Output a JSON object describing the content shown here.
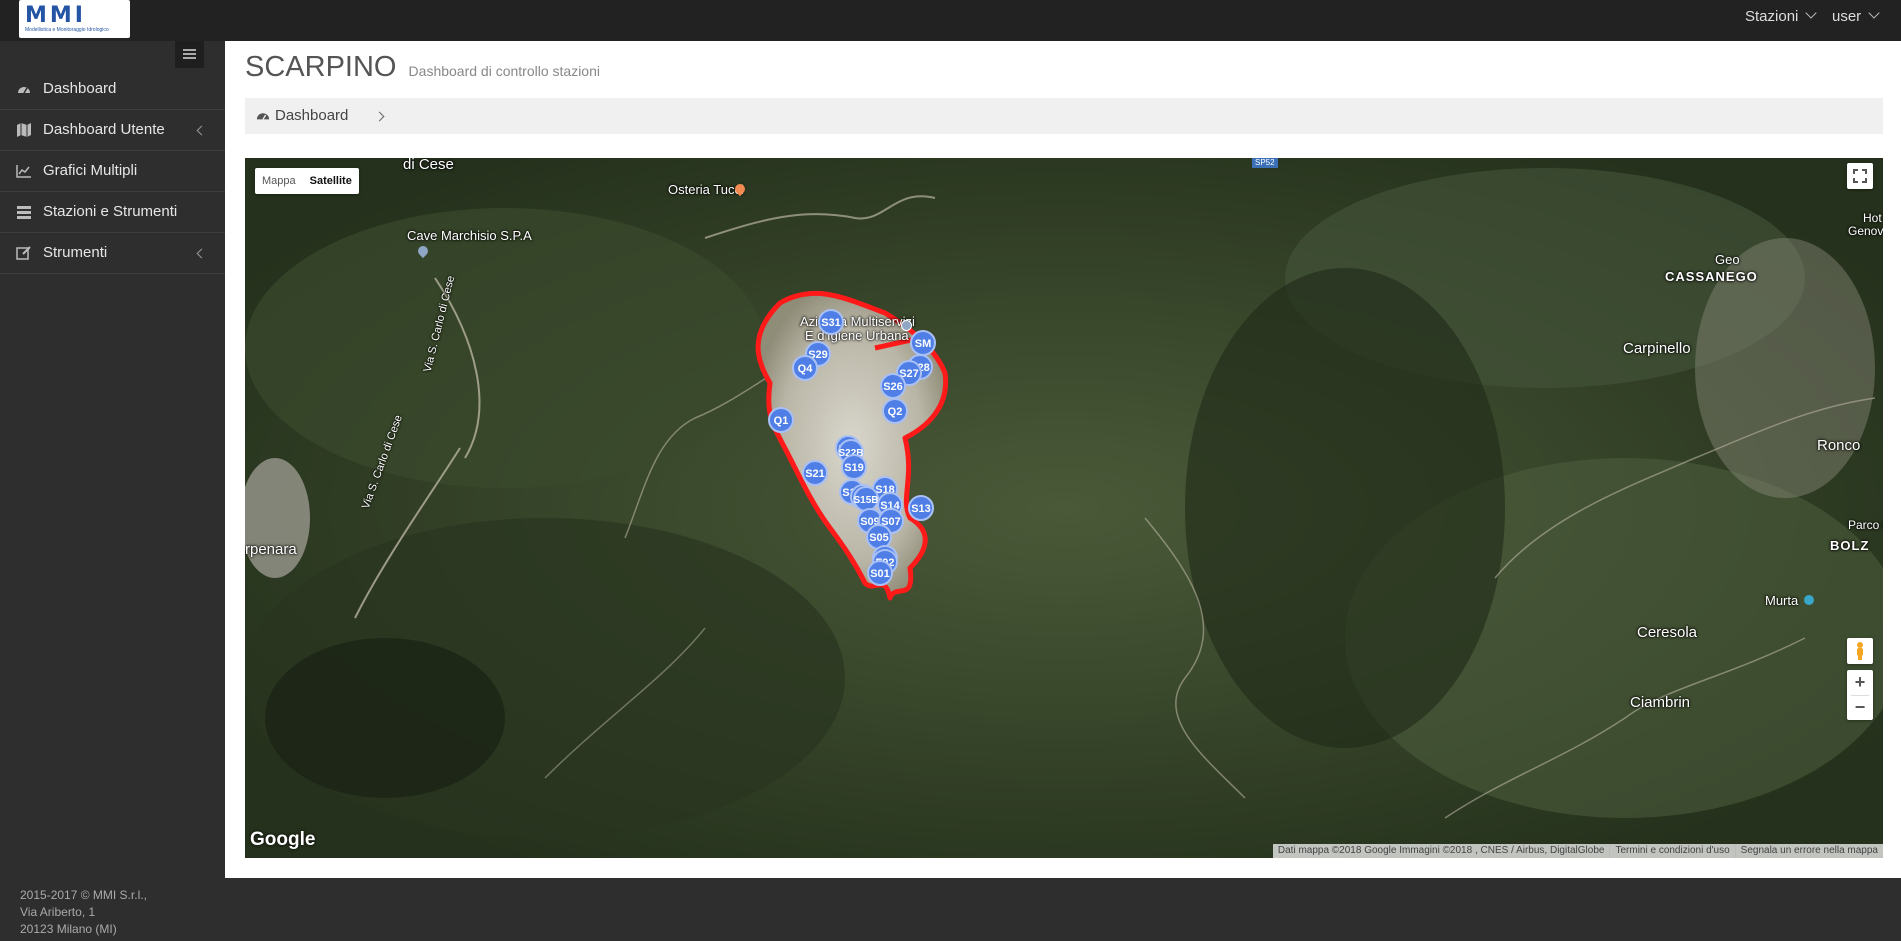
{
  "navbar": {
    "logo_text": "MMI",
    "logo_subtitle": "Modellistica e Monitoraggio Idrologico",
    "stazioni_label": "Stazioni",
    "user_label": "user"
  },
  "sidebar": {
    "items": [
      {
        "label": "Dashboard",
        "icon": "dashboard-icon",
        "has_submenu": false
      },
      {
        "label": "Dashboard Utente",
        "icon": "map-icon",
        "has_submenu": true
      },
      {
        "label": "Grafici Multipli",
        "icon": "line-chart-icon",
        "has_submenu": false
      },
      {
        "label": "Stazioni e Strumenti",
        "icon": "list-icon",
        "has_submenu": false
      },
      {
        "label": "Strumenti",
        "icon": "edit-icon",
        "has_submenu": true
      }
    ],
    "footer": {
      "line1": "2015-2017 © MMI S.r.l.,",
      "line2": "Via Ariberto, 1",
      "line3": "20123 Milano (MI)"
    }
  },
  "page": {
    "title": "SCARPINO",
    "subtitle": "Dashboard di controllo stazioni"
  },
  "breadcrumb": {
    "item": "Dashboard"
  },
  "map": {
    "type_buttons": {
      "map": "Mappa",
      "satellite": "Satellite",
      "active": "Satellite"
    },
    "places": {
      "cese": "di Cese",
      "osteria": "Osteria Tucci",
      "cave": "Cave Marchisio S.P.A",
      "via_cese_1": "Via S. Carlo di Cese",
      "via_cese_2": "Via S. Carlo di Cese",
      "amiu_1": "Azienda Multiservizi",
      "amiu_2": "E d'Igiene Urbana",
      "geo": "Geo",
      "cassanego": "CASSANEGO",
      "hotel_1": "Hot",
      "hotel_2": "Genova",
      "carpinello": "Carpinello",
      "ronco": "Ronco",
      "parco": "Parco D",
      "bolz": "BOLZ",
      "murta": "Murta",
      "ceresola": "Ceresola",
      "ciambrin": "Ciambrin",
      "penara": "rpenara",
      "road_badge": "SP52"
    },
    "station_markers": [
      "S31",
      "SM",
      "S29",
      "Q4",
      "S28",
      "S27",
      "S26",
      "Q2",
      "Q1",
      "S22",
      "S22B",
      "S21",
      "S19",
      "S18",
      "S17",
      "S15",
      "S15B",
      "S14",
      "S13",
      "S09",
      "S07",
      "S05",
      "F01",
      "F02",
      "S01"
    ],
    "google_logo": "Google",
    "attribution": [
      "Dati mappa ©2018 Google Immagini ©2018 , CNES / Airbus, DigitalGlobe",
      "Termini e condizioni d'uso",
      "Segnala un errore nella mappa"
    ],
    "zoom_in": "+",
    "zoom_out": "−",
    "colors": {
      "boundary": "#ff1a1a",
      "marker": "#4f7fe6"
    }
  }
}
